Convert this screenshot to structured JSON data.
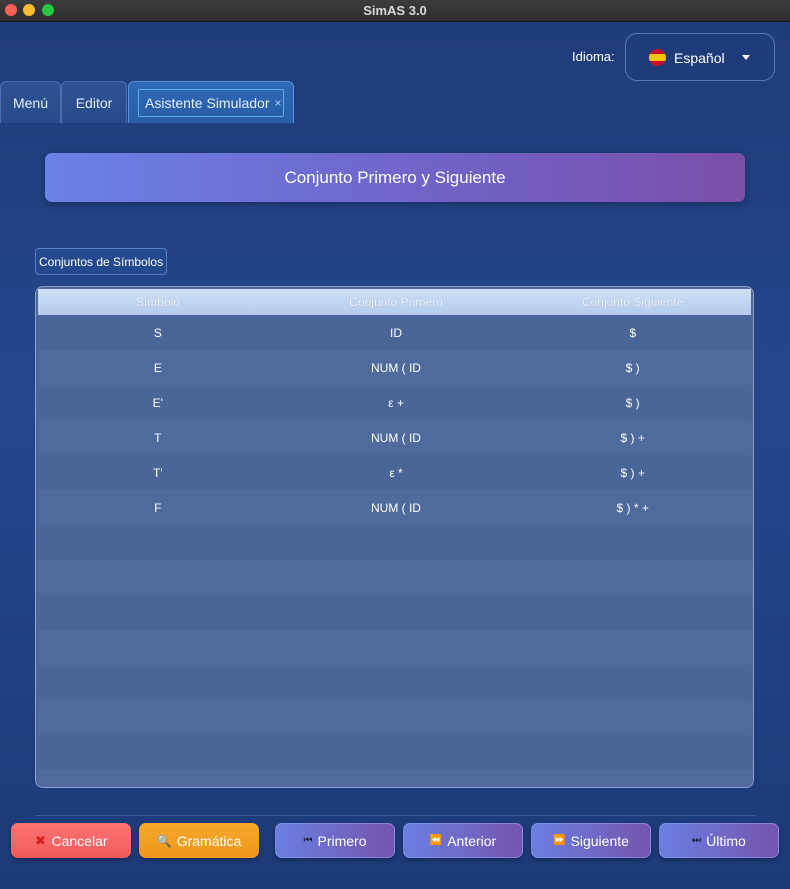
{
  "window": {
    "title": "SimAS 3.0"
  },
  "language": {
    "label": "Idioma:",
    "selected": "Español",
    "flag": "spain-flag"
  },
  "tabs": [
    {
      "label": "Menú"
    },
    {
      "label": "Editor"
    },
    {
      "label": "Asistente Simulador",
      "close": "×"
    }
  ],
  "header": {
    "title": "Conjunto Primero y Siguiente"
  },
  "section": {
    "label": "Conjuntos de Símbolos"
  },
  "table": {
    "columns": [
      "Símbolo",
      "Conjunto Primero",
      "Conjunto Siguiente"
    ],
    "rows": [
      [
        "S",
        "ID",
        "$"
      ],
      [
        "E",
        "NUM ( ID",
        "$ )"
      ],
      [
        "E'",
        "ε +",
        "$ )"
      ],
      [
        "T",
        "NUM ( ID",
        "$ ) +"
      ],
      [
        "T'",
        "ε *",
        "$ ) +"
      ],
      [
        "F",
        "NUM ( ID",
        "$ ) * +"
      ],
      [
        "",
        "",
        ""
      ],
      [
        "",
        "",
        ""
      ],
      [
        "",
        "",
        ""
      ],
      [
        "",
        "",
        ""
      ],
      [
        "",
        "",
        ""
      ],
      [
        "",
        "",
        ""
      ],
      [
        "",
        "",
        ""
      ],
      [
        "",
        "",
        ""
      ]
    ]
  },
  "buttons": {
    "cancel": "Cancelar",
    "grammar": "Gramática",
    "first": "Primero",
    "prev": "Anterior",
    "next": "Siguiente",
    "last": "Último"
  },
  "colors": {
    "background": "#24478d",
    "cancel": "#f15a5a",
    "grammar": "#ee961b",
    "nav_start": "#6a7fe2",
    "nav_end": "#7455ad"
  }
}
